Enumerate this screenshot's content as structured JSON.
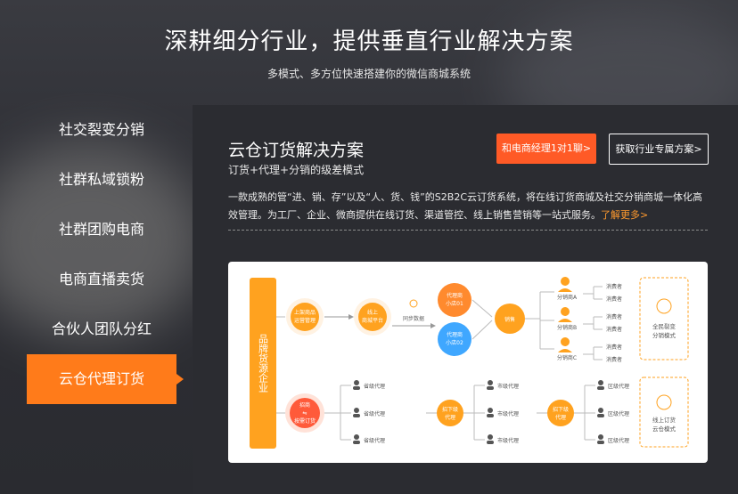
{
  "header": {
    "title": "深耕细分行业，提供垂直行业解决方案",
    "subtitle": "多模式、多方位快速搭建你的微信商城系统"
  },
  "sidebar": {
    "items": [
      {
        "label": "社交裂变分销",
        "active": false
      },
      {
        "label": "社群私域锁粉",
        "active": false
      },
      {
        "label": "社群团购电商",
        "active": false
      },
      {
        "label": "电商直播卖货",
        "active": false
      },
      {
        "label": "合伙人团队分红",
        "active": false
      },
      {
        "label": "云仓代理订货",
        "active": true
      }
    ]
  },
  "panel": {
    "title": "云仓订货解决方案",
    "subtitle": "订货+代理+分销的级差模式",
    "btn_primary": "和电商经理1对1聊>",
    "btn_secondary": "获取行业专属方案>",
    "description": "一款成熟的管“进、销、存”以及“人、货、钱”的S2B2C云订货系统，将在线订货商城及社交分销商城一体化高效管理。为工厂、企业、微商提供在线订货、渠道管控、线上销售营销等一站式服务。",
    "more": "了解更多>"
  },
  "diagram": {
    "source": "品牌货源企业",
    "upload": [
      "上架商品",
      "运营管理"
    ],
    "platform": [
      "线上",
      "商城平台"
    ],
    "sync": "同步数据",
    "agentA": [
      "代理商",
      "小店01"
    ],
    "agentB": [
      "代理商",
      "小店02"
    ],
    "sell": "销售",
    "distributors": [
      "分销商A",
      "分销商B",
      "分销商C"
    ],
    "consumer": "消费者",
    "right_top": [
      "全民裂变",
      "分销模式"
    ],
    "right_bottom": [
      "线上订货",
      "云仓模式"
    ],
    "recruit": [
      "招商",
      "⇋",
      "按需订货"
    ],
    "province": "省级代理",
    "city": "市级代理",
    "district": "区级代理",
    "downline": [
      "招下级",
      "代理"
    ],
    "colors": {
      "orange": "#ffa21f",
      "blue": "#3fa7ff",
      "red": "#ff5a3a",
      "pale": "#fff2e2"
    }
  }
}
